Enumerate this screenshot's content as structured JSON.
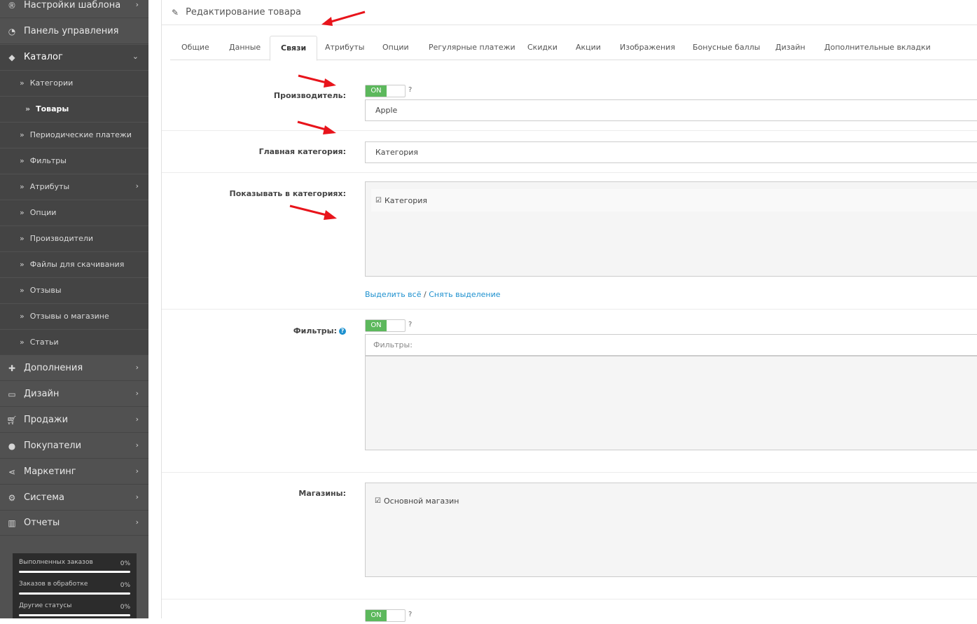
{
  "sidebar": {
    "items": [
      {
        "label": "Настройки шаблона",
        "icon": "registered-icon",
        "chevron": true
      },
      {
        "label": "Панель управления",
        "icon": "dashboard-icon",
        "chevron": false
      },
      {
        "label": "Каталог",
        "icon": "tags-icon",
        "chevron": true,
        "chevron_dir": "down"
      },
      {
        "label": "Дополнения",
        "icon": "puzzle-icon",
        "chevron": true
      },
      {
        "label": "Дизайн",
        "icon": "monitor-icon",
        "chevron": true
      },
      {
        "label": "Продажи",
        "icon": "cart-icon",
        "chevron": true
      },
      {
        "label": "Покупатели",
        "icon": "user-icon",
        "chevron": true
      },
      {
        "label": "Маркетинг",
        "icon": "share-icon",
        "chevron": true
      },
      {
        "label": "Система",
        "icon": "gear-icon",
        "chevron": true
      },
      {
        "label": "Отчеты",
        "icon": "bar-chart-icon",
        "chevron": true
      }
    ],
    "catalog_sub": [
      {
        "label": "Категории"
      },
      {
        "label": "Товары"
      },
      {
        "label": "Периодические платежи"
      },
      {
        "label": "Фильтры"
      },
      {
        "label": "Атрибуты"
      },
      {
        "label": "Опции"
      },
      {
        "label": "Производители"
      },
      {
        "label": "Файлы для скачивания"
      },
      {
        "label": "Отзывы"
      },
      {
        "label": "Отзывы о магазине"
      },
      {
        "label": "Статьи"
      }
    ],
    "stats": [
      {
        "label": "Выполненных заказов",
        "value": "0%"
      },
      {
        "label": "Заказов в обработке",
        "value": "0%"
      },
      {
        "label": "Другие статусы",
        "value": "0%"
      }
    ]
  },
  "page": {
    "title": "Редактирование товара"
  },
  "tabs": [
    "Общие",
    "Данные",
    "Связи",
    "Атрибуты",
    "Опции",
    "Регулярные платежи",
    "Скидки",
    "Акции",
    "Изображения",
    "Бонусные баллы",
    "Дизайн",
    "Дополнительные вкладки"
  ],
  "active_tab": "Связи",
  "form": {
    "manufacturer": {
      "label": "Производитель:",
      "toggle": "ON",
      "q": "?",
      "value": "Apple"
    },
    "main_category": {
      "label": "Главная категория:",
      "value": "Категория"
    },
    "show_in_categories": {
      "label": "Показывать в категориях:",
      "checked_item": "Категория",
      "select_all": "Выделить всё",
      "sep": "/",
      "deselect": "Снять выделение"
    },
    "filters": {
      "label": "Фильтры:",
      "help": "?",
      "toggle": "ON",
      "q": "?",
      "placeholder": "Фильтры:"
    },
    "stores": {
      "label": "Магазины:",
      "checked_item": "Основной магазин"
    },
    "bottom": {
      "toggle": "ON",
      "q": "?"
    }
  },
  "colors": {
    "sidebar_bg": "#515151",
    "toggle_on": "#5cb85c",
    "link": "#1e91cf",
    "annotation_arrow": "#e8141b"
  }
}
